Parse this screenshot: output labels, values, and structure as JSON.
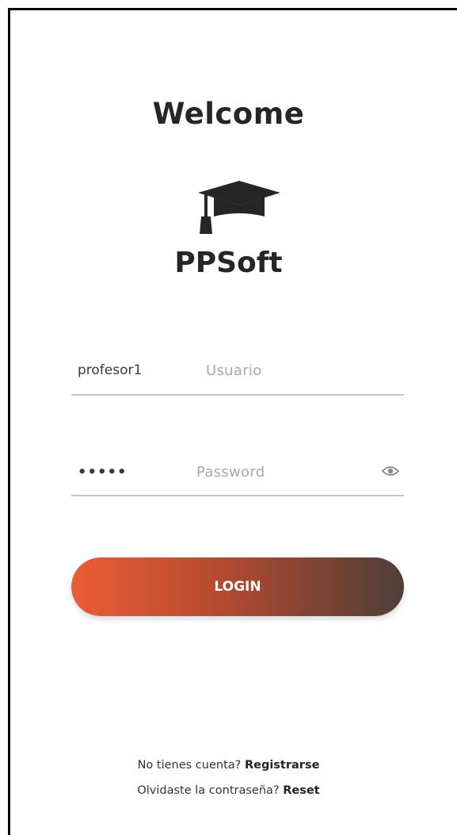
{
  "title": "Welcome",
  "brand": "PPSoft",
  "logo_icon": "graduation-cap-icon",
  "username": {
    "value": "profesor1",
    "placeholder": "Usuario"
  },
  "password": {
    "value": "•••••",
    "placeholder": "Password",
    "toggle_icon": "eye-icon"
  },
  "login_button": "LOGIN",
  "register": {
    "prompt": "No tienes cuenta? ",
    "link": "Registrarse"
  },
  "reset": {
    "prompt": "Olvidaste la contraseña? ",
    "link": "Reset"
  },
  "colors": {
    "gradient_start": "#ec5d35",
    "gradient_end": "#4d3f38",
    "text": "#262626"
  }
}
